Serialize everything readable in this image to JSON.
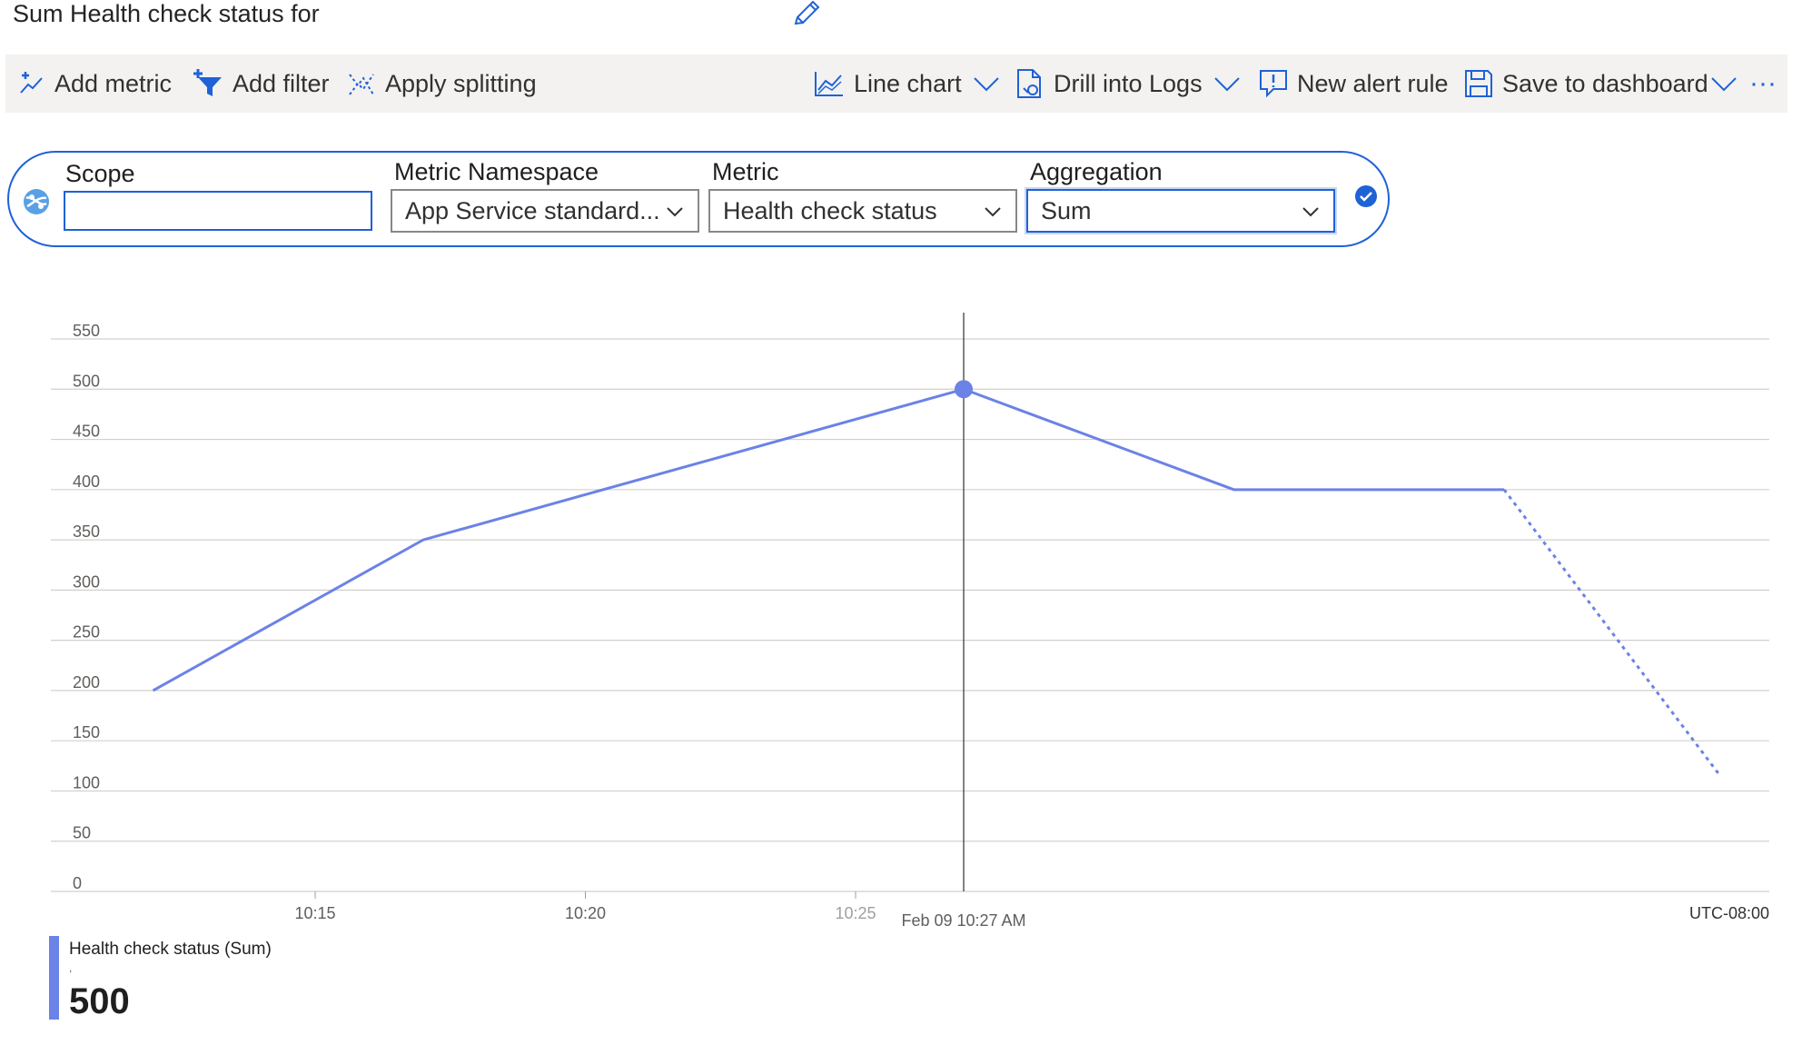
{
  "header": {
    "title": "Sum Health check status for"
  },
  "toolbar": {
    "add_metric": "Add metric",
    "add_filter": "Add filter",
    "apply_splitting": "Apply splitting",
    "line_chart": "Line chart",
    "drill_into_logs": "Drill into Logs",
    "new_alert_rule": "New alert rule",
    "save_to_dashboard": "Save to dashboard",
    "more": "···"
  },
  "query": {
    "scope_label": "Scope",
    "scope_value": "",
    "namespace_label": "Metric Namespace",
    "namespace_value": "App Service standard...",
    "metric_label": "Metric",
    "metric_value": "Health check status",
    "aggregation_label": "Aggregation",
    "aggregation_value": "Sum"
  },
  "colors": {
    "accent": "#1f62d6",
    "series": "#6b82e6",
    "toolbar_bg": "#f3f2f1"
  },
  "chart_data": {
    "type": "line",
    "y_ticks": [
      "550",
      "500",
      "450",
      "400",
      "350",
      "300",
      "250",
      "200",
      "150",
      "100",
      "50",
      "0"
    ],
    "ylim": [
      0,
      550
    ],
    "grid": true,
    "x_tick_labels": [
      "10:15",
      "10:20",
      "10:25"
    ],
    "timezone": "UTC-08:00",
    "cursor_label": "Feb 09 10:27 AM",
    "series": [
      {
        "name": "Health check status (Sum)",
        "points": [
          {
            "x": "10:12",
            "y": 200
          },
          {
            "x": "10:17",
            "y": 350
          },
          {
            "x": "10:27",
            "y": 500
          },
          {
            "x": "10:32",
            "y": 400
          },
          {
            "x": "10:37",
            "y": 400
          }
        ],
        "partial_points": [
          {
            "x": "10:37",
            "y": 400
          },
          {
            "x": "10:41",
            "y": 115
          }
        ]
      }
    ],
    "highlight": {
      "x": "10:27",
      "y": 500
    }
  },
  "legend": {
    "name": "Health check status (Sum)",
    "sub": ",",
    "value": "500"
  }
}
